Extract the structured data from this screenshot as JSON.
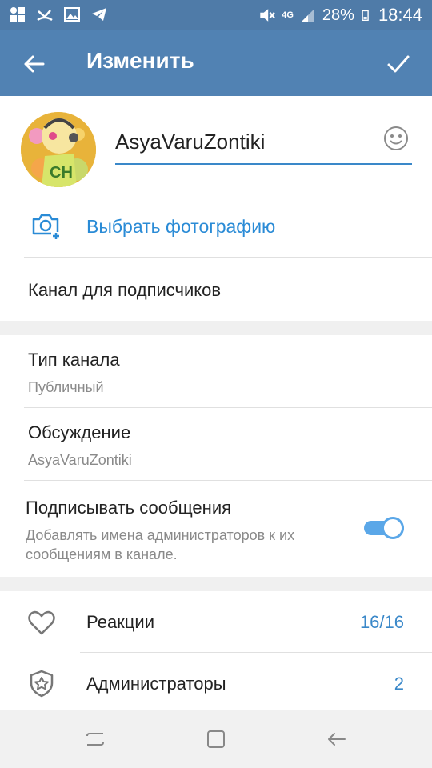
{
  "statusbar": {
    "battery": "28%",
    "time": "18:44",
    "network": "4G",
    "icons_left": [
      "apps-icon",
      "missed-call-icon",
      "image-icon",
      "telegram-icon"
    ],
    "icons_right": [
      "mute-icon",
      "network-icon",
      "signal-icon",
      "battery-icon"
    ]
  },
  "appbar": {
    "title": "Изменить",
    "back_icon": "back-arrow-icon",
    "confirm_icon": "check-icon"
  },
  "profile": {
    "channel_name": "AsyaVaruZontiki",
    "emoji_icon": "emoji-icon",
    "choose_photo_label": "Выбрать фотографию",
    "avatar_text": "CH",
    "description": "Канал для подписчиков"
  },
  "settings": {
    "channel_type_title": "Тип канала",
    "channel_type_value": "Публичный",
    "discussion_title": "Обсуждение",
    "discussion_value": "AsyaVaruZontiki",
    "sign_messages_title": "Подписывать сообщения",
    "sign_messages_desc": "Добавлять имена администраторов к их сообщениям в канале.",
    "sign_messages_enabled": true
  },
  "items": [
    {
      "label": "Реакции",
      "value": "16/16",
      "icon": "heart-icon"
    },
    {
      "label": "Администраторы",
      "value": "2",
      "icon": "shield-star-icon"
    }
  ],
  "navbar": {
    "icons": [
      "recent-apps-icon",
      "home-icon",
      "back-icon"
    ]
  },
  "colors": {
    "appbar": "#5182b3",
    "statusbar": "#4f7ba8",
    "accent": "#2a8bd6",
    "toggle": "#5aa7e8"
  }
}
